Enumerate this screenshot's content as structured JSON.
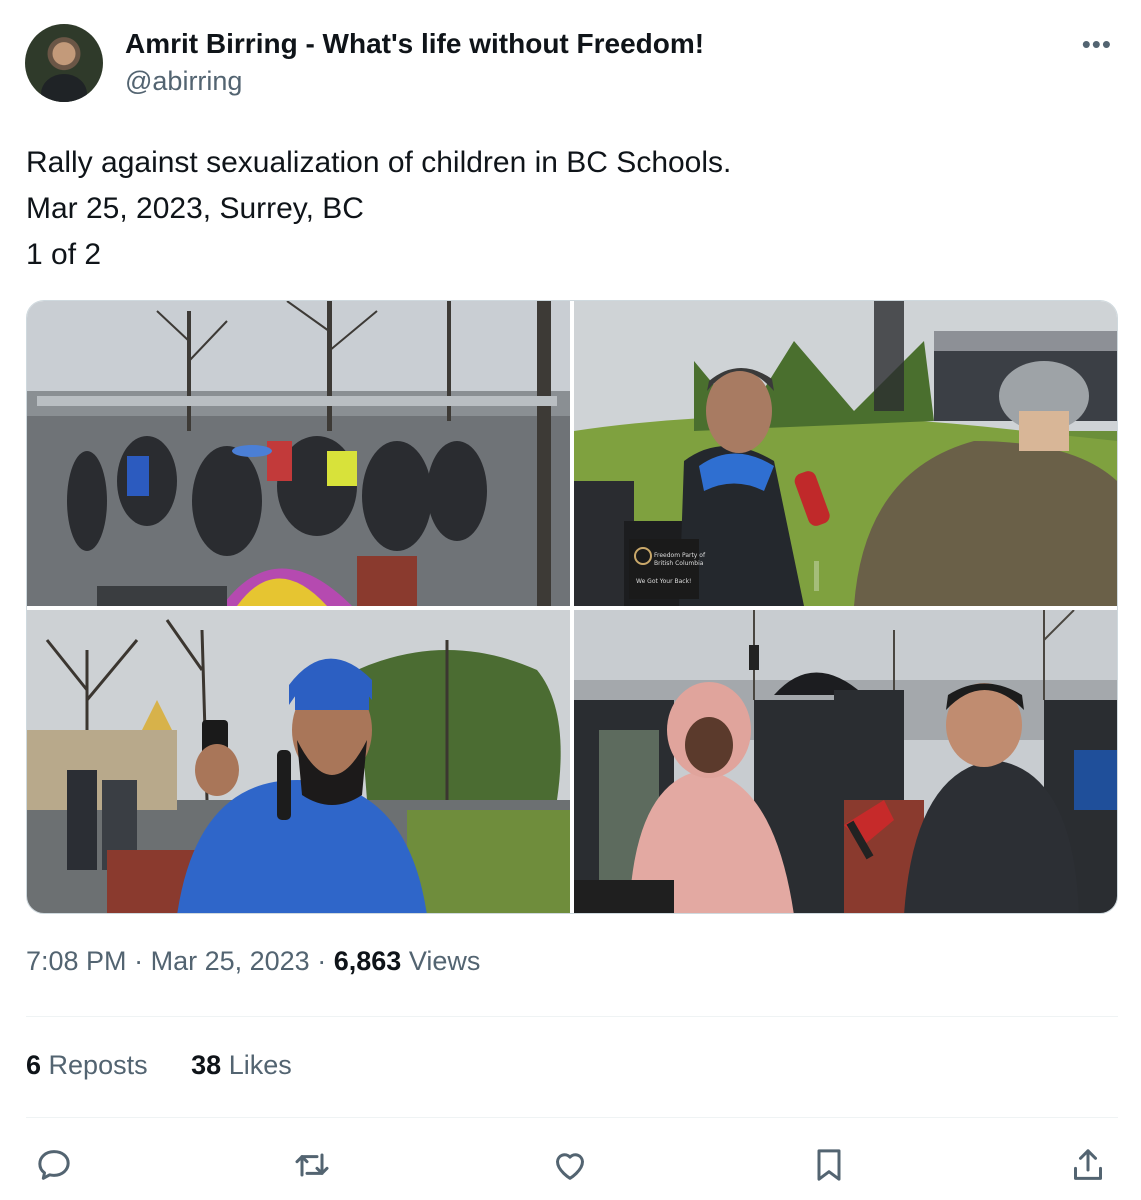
{
  "author": {
    "display_name": "Amrit Birring - What's life without Freedom!",
    "handle": "@abirring"
  },
  "tweet": {
    "lines": [
      "Rally against sexualization of children in BC Schools.",
      "Mar 25, 2023, Surrey, BC",
      "1 of 2"
    ]
  },
  "media": [
    {
      "description": "crowd-rally-street"
    },
    {
      "description": "interview-man-blue-hoodie"
    },
    {
      "description": "man-turban-speaking-microphone"
    },
    {
      "description": "reporter-pink-jacket-interview"
    }
  ],
  "media_signage": {
    "sign_line1": "Freedom Party of",
    "sign_line2": "British Columbia",
    "sign_line3": "We Got Your Back!"
  },
  "meta": {
    "time": "7:08 PM",
    "separator": "·",
    "date": "Mar 25, 2023",
    "views_count": "6,863",
    "views_label": "Views"
  },
  "stats": {
    "reposts_count": "6",
    "reposts_label": "Reposts",
    "likes_count": "38",
    "likes_label": "Likes"
  },
  "icons": {
    "more": "more-horizontal-icon",
    "reply": "reply-icon",
    "repost": "repost-icon",
    "like": "heart-icon",
    "bookmark": "bookmark-icon",
    "share": "share-icon"
  },
  "colors": {
    "text_primary": "#0f1419",
    "text_secondary": "#536471",
    "border": "#cfd9de",
    "divider": "#eff3f4"
  }
}
